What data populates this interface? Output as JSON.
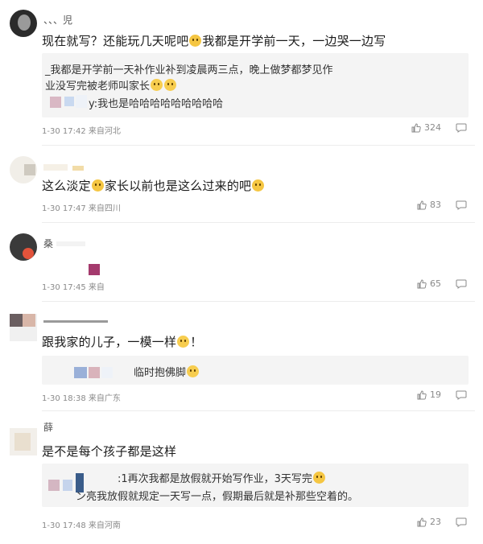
{
  "comments": [
    {
      "username": "、、、児",
      "text_a": "现在就写？还能玩几天呢吧",
      "text_b": "我都是开学前一天，一边哭一边写",
      "replies": [
        {
          "prefix": "_",
          "text": "我都是开学前一天补作业补到凌晨两三点，晚上做梦都梦见作"
        },
        {
          "prefix": "",
          "text": "业没写完被老师叫家长"
        },
        {
          "prefix": "y:",
          "text": "我也是哈哈哈哈哈哈哈哈哈"
        }
      ],
      "time": "1-30 17:42",
      "location": "来自河北",
      "likes": "324"
    },
    {
      "username": "",
      "text_a": "这么淡定",
      "text_b": "家长以前也是这么过来的吧",
      "replies": [],
      "time": "1-30 17:47",
      "location": "来自四川",
      "likes": "83"
    },
    {
      "username": "桑",
      "text_a": "",
      "text_b": "",
      "replies": [],
      "time": "1-30 17:45",
      "location": "来自",
      "likes": "65"
    },
    {
      "username": "",
      "text_a": "跟我家的儿子，一模一样",
      "text_b": "！",
      "replies": [
        {
          "prefix": "",
          "text": "临时抱佛脚"
        }
      ],
      "time": "1-30 18:38",
      "location": "来自广东",
      "likes": "19"
    },
    {
      "username": "薛",
      "text_a": "是不是每个孩子都是这样",
      "text_b": "",
      "replies": [
        {
          "prefix": ":1再次",
          "text": "我都是放假就开始写作业，3天写完"
        },
        {
          "prefix": "ン亮",
          "text": "我放假就规定一天写一点，假期最后就是补那些空着的。"
        }
      ],
      "time": "1-30 17:48",
      "location": "来自河南",
      "likes": "23"
    }
  ],
  "icons": {
    "like": "thumbs-up-icon",
    "reply": "comment-icon"
  },
  "colors": {
    "meta": "#8a8a8a",
    "replyBg": "#f4f4f4"
  }
}
